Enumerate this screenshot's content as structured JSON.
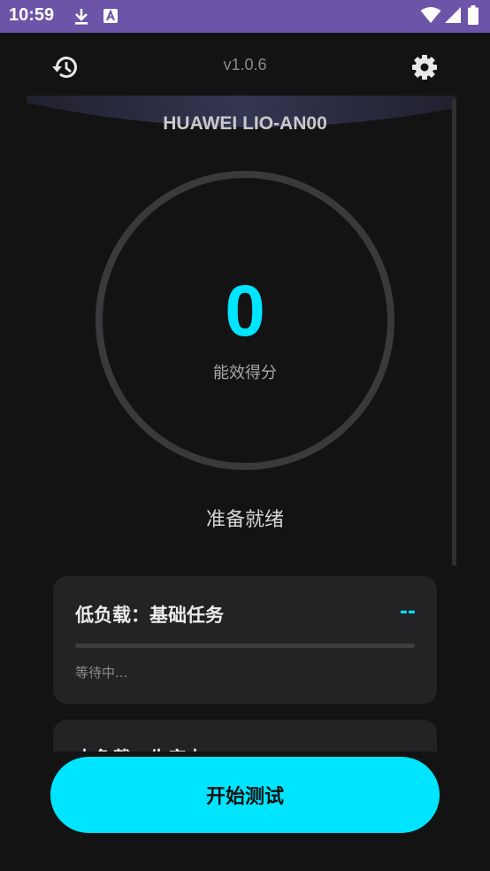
{
  "status_bar": {
    "time": "10:59",
    "icons": [
      "download-icon",
      "app-notification-icon",
      "wifi-icon",
      "signal-icon",
      "battery-icon"
    ]
  },
  "header": {
    "version": "v1.0.6",
    "history_icon": "history-icon",
    "settings_icon": "gear-icon"
  },
  "device": {
    "name": "HUAWEI LIO-AN00"
  },
  "score": {
    "value": "0",
    "label": "能效得分",
    "status": "准备就绪"
  },
  "tasks": [
    {
      "title": "低负载：基础任务",
      "value": "--",
      "status": "等待中...",
      "progress": 0
    },
    {
      "title": "中负载：生产力"
    }
  ],
  "actions": {
    "start_label": "开始测试"
  },
  "colors": {
    "accent": "#00e5ff",
    "statusbar": "#6c54a8",
    "background": "#131314",
    "card": "#232325"
  }
}
